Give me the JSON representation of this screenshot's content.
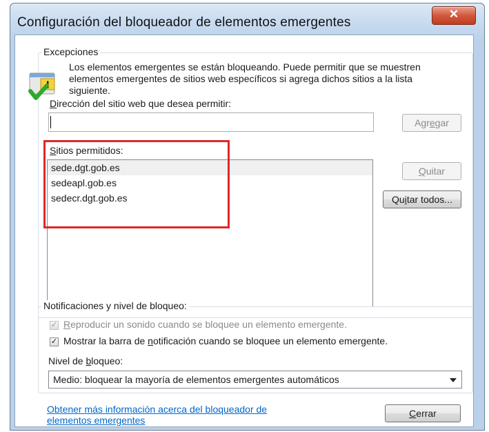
{
  "window": {
    "title": "Configuración del bloqueador de elementos emergentes",
    "close_glyph": "✕"
  },
  "exceptions": {
    "group_label": "Excepciones",
    "description": "Los elementos emergentes se están bloqueando. Puede permitir que se muestren elementos emergentes de sitios web específicos si agrega dichos sitios a la lista siguiente.",
    "address_label_u": "D",
    "address_label_rest": "irección del sitio web que desea permitir:",
    "address_value": "",
    "add_button_a": "Agr",
    "add_button_u": "e",
    "add_button_b": "gar",
    "allowed_label_u": "S",
    "allowed_label_rest": "itios permitidos:",
    "sites": [
      "sede.dgt.gob.es",
      "sedeapl.gob.es",
      "sedecr.dgt.gob.es"
    ],
    "remove_button_u": "Q",
    "remove_button_rest": "uitar",
    "remove_all_a": "Qu",
    "remove_all_u": "i",
    "remove_all_b": "tar todos..."
  },
  "notifications": {
    "group_label": "Notificaciones y nivel de bloqueo:",
    "play_sound_u": "R",
    "play_sound_rest": "eproducir un sonido cuando se bloquee un elemento emergente.",
    "play_sound_checked": true,
    "show_bar_a": "Mostrar la barra de ",
    "show_bar_u": "n",
    "show_bar_b": "otificación cuando se bloquee un elemento emergente.",
    "show_bar_checked": true,
    "level_label_a": "Nivel de ",
    "level_label_u": "b",
    "level_label_b": "loqueo:",
    "level_value": "Medio: bloquear la mayoría de elementos emergentes automáticos"
  },
  "footer": {
    "more_info_link": "Obtener más información acerca del bloqueador de elementos emergentes",
    "close_button_u": "C",
    "close_button_rest": "errar"
  },
  "colors": {
    "highlight_box": "#e0262a",
    "link": "#0066cc"
  }
}
